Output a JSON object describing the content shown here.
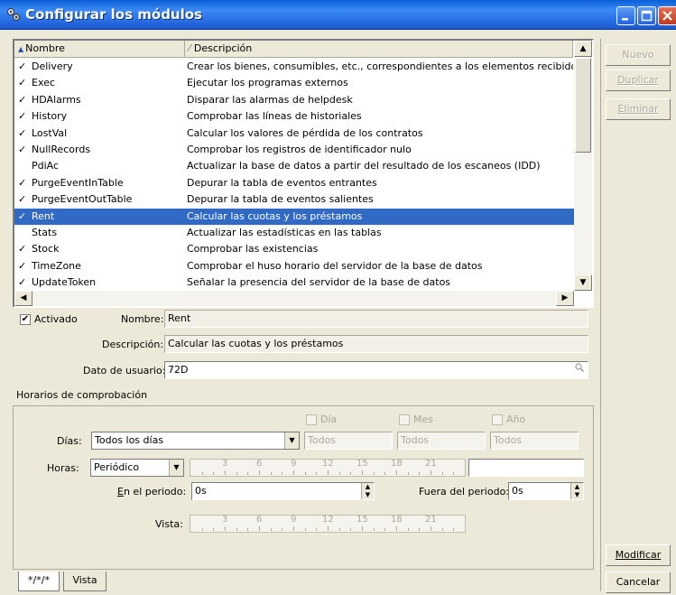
{
  "window": {
    "title": "Configurar los módulos"
  },
  "list": {
    "col_name": "Nombre",
    "col_desc": "Descripción",
    "rows": [
      {
        "checked": true,
        "name": "Delivery",
        "desc": "Crear los bienes, consumibles, etc., correspondientes a los elementos recibidos"
      },
      {
        "checked": true,
        "name": "Exec",
        "desc": "Ejecutar los programas externos"
      },
      {
        "checked": true,
        "name": "HDAlarms",
        "desc": "Disparar las alarmas de helpdesk"
      },
      {
        "checked": true,
        "name": "History",
        "desc": "Comprobar las líneas de historiales"
      },
      {
        "checked": true,
        "name": "LostVal",
        "desc": "Calcular los valores de pérdida de los contratos"
      },
      {
        "checked": true,
        "name": "NullRecords",
        "desc": "Comprobar los registros de identificador nulo"
      },
      {
        "checked": false,
        "name": "PdiAc",
        "desc": "Actualizar la base de datos a partir del resultado de los escaneos (IDD)"
      },
      {
        "checked": true,
        "name": "PurgeEventInTable",
        "desc": "Depurar la tabla de eventos entrantes"
      },
      {
        "checked": true,
        "name": "PurgeEventOutTable",
        "desc": "Depurar la tabla de eventos salientes"
      },
      {
        "checked": true,
        "name": "Rent",
        "desc": "Calcular las cuotas y los préstamos",
        "selected": true
      },
      {
        "checked": false,
        "name": "Stats",
        "desc": "Actualizar las estadísticas en las tablas"
      },
      {
        "checked": true,
        "name": "Stock",
        "desc": "Comprobar las existencias"
      },
      {
        "checked": true,
        "name": "TimeZone",
        "desc": "Comprobar el huso horario del servidor de la base de datos"
      },
      {
        "checked": true,
        "name": "UpdateToken",
        "desc": "Señalar la presencia del servidor de la base de datos"
      }
    ]
  },
  "buttons": {
    "new": "Nuevo",
    "duplicate": "Duplicar",
    "delete": "Eliminar",
    "modify": "Modificar",
    "cancel": "Cancelar"
  },
  "detail": {
    "activated_label": "Activado",
    "activated": true,
    "name_label": "Nombre:",
    "name_value": "Rent",
    "desc_label": "Descripción:",
    "desc_value": "Calcular las cuotas y los préstamos",
    "userdata_label": "Dato de usuario:",
    "userdata_value": "72D"
  },
  "schedule": {
    "group_label": "Horarios de comprobación",
    "day_check": "Día",
    "month_check": "Mes",
    "year_check": "Año",
    "days_label": "Días:",
    "days_value": "Todos los días",
    "all_day": "Todos",
    "all_month": "Todos",
    "all_year": "Todos",
    "hours_label": "Horas:",
    "hours_value": "Periódico",
    "ruler_ticks": [
      "3",
      "6",
      "9",
      "12",
      "15",
      "18",
      "21"
    ],
    "in_period_label": "En el periodo:",
    "in_period_value": "0s",
    "out_period_label": "Fuera del periodo:",
    "out_period_value": "0s",
    "view_label": "Vista:"
  },
  "tabs": {
    "pattern": "*/*/*",
    "view": "Vista"
  }
}
